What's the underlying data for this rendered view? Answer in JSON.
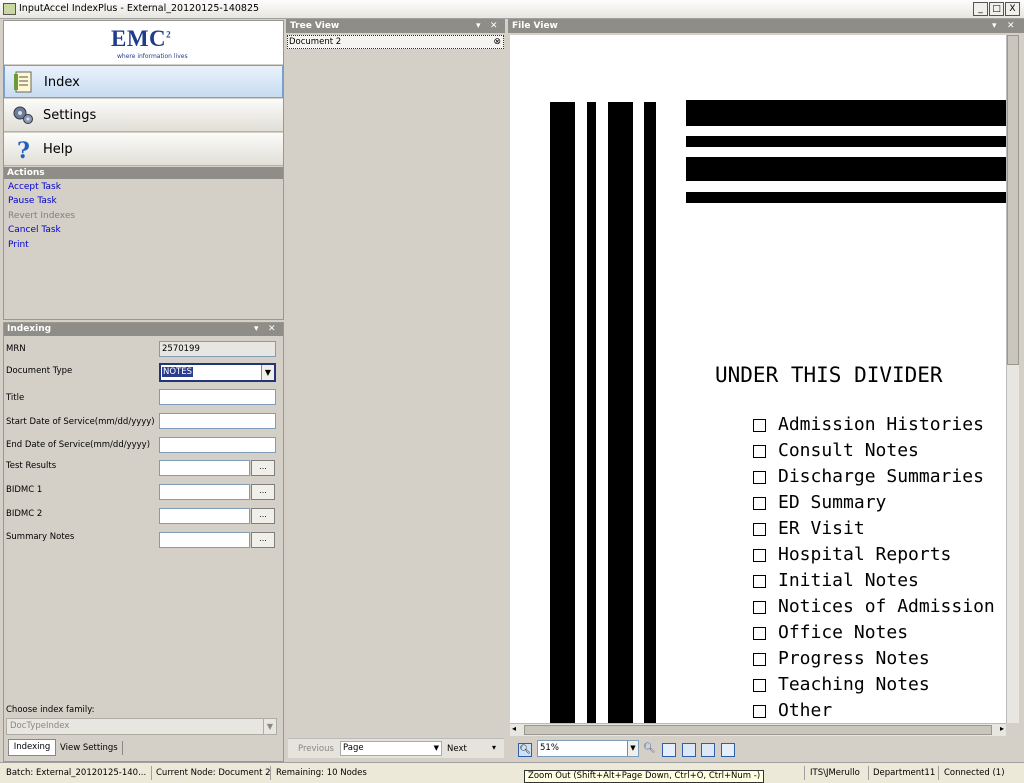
{
  "window": {
    "title": "InputAccel IndexPlus - External_20120125-140825",
    "min": "_",
    "max": "□",
    "close": "X"
  },
  "logo": {
    "brand": "EMC",
    "sup": "2",
    "tagline": "where information lives"
  },
  "nav": {
    "index": "Index",
    "settings": "Settings",
    "help": "Help"
  },
  "actions": {
    "header": "Actions",
    "items": [
      "Accept Task",
      "Pause Task",
      "Revert Indexes",
      "Cancel Task",
      "Print"
    ]
  },
  "indexing": {
    "header": "Indexing",
    "fields": [
      {
        "label": "MRN",
        "value": "2570199"
      },
      {
        "label": "Document Type",
        "value": "NOTES"
      },
      {
        "label": "Title",
        "value": ""
      },
      {
        "label": "Start Date of Service(mm/dd/yyyy)",
        "value": ""
      },
      {
        "label": "End Date of Service(mm/dd/yyyy)",
        "value": ""
      },
      {
        "label": "Test Results",
        "value": ""
      },
      {
        "label": "BIDMC 1",
        "value": ""
      },
      {
        "label": "BIDMC 2",
        "value": ""
      },
      {
        "label": "Summary Notes",
        "value": ""
      }
    ],
    "ellipsis": "...",
    "family_label": "Choose index family:",
    "family_value": "DocTypeIndex",
    "tabs": [
      "Indexing",
      "View Settings"
    ]
  },
  "tree": {
    "header": "Tree View",
    "node": "Document 2",
    "prev": "Previous",
    "page": "Page",
    "next": "Next"
  },
  "fileview": {
    "header": "File View",
    "zoom": "51%",
    "tooltip": "Zoom Out (Shift+Alt+Page Down, Ctrl+O, Ctrl+Num -)",
    "doc_title": "UNDER THIS DIVIDER",
    "doc_items": [
      "Admission Histories",
      "Consult Notes",
      "Discharge Summaries",
      "ED Summary",
      "ER Visit",
      "Hospital Reports",
      "Initial Notes",
      "Notices of Admission",
      "Office Notes",
      "Progress Notes",
      "Teaching Notes",
      "Other"
    ]
  },
  "status": {
    "batch": "Batch: External_20120125-140...",
    "node": "Current Node: Document 2",
    "remaining": "Remaining: 10 Nodes",
    "user": "ITS\\JMerullo",
    "dept": "Department11",
    "conn": "Connected (1)"
  }
}
